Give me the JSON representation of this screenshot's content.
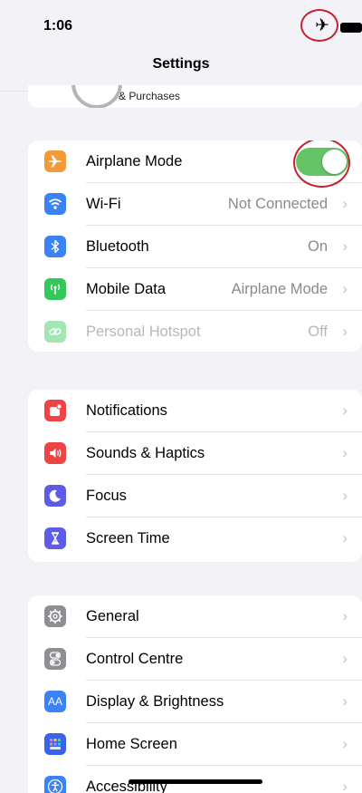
{
  "status_bar": {
    "time": "1:06"
  },
  "nav": {
    "title": "Settings"
  },
  "account": {
    "subtitle": "& Purchases"
  },
  "colors": {
    "accent_toggle": "#65c466",
    "annotation_ring": "#c8202f",
    "airplane": "#f19a37",
    "wifi": "#3b82f6",
    "bluetooth": "#3b82f6",
    "mobile_data": "#34c759",
    "hotspot": "#34c759",
    "notifications": "#ef4444",
    "sounds": "#ef4444",
    "focus": "#5e5ce6",
    "screen_time": "#5e5ce6",
    "general": "#8e8e93",
    "control_centre": "#8e8e93",
    "display": "#3b82f6",
    "home_screen": "#3b62ea",
    "accessibility": "#3b82f6"
  },
  "groups": {
    "connectivity": [
      {
        "label": "Airplane Mode",
        "icon": "airplane-icon",
        "toggle_on": true
      },
      {
        "label": "Wi-Fi",
        "value": "Not Connected",
        "icon": "wifi-icon"
      },
      {
        "label": "Bluetooth",
        "value": "On",
        "icon": "bluetooth-icon"
      },
      {
        "label": "Mobile Data",
        "value": "Airplane Mode",
        "icon": "antenna-icon"
      },
      {
        "label": "Personal Hotspot",
        "value": "Off",
        "icon": "hotspot-icon",
        "disabled": true
      }
    ],
    "alerts": [
      {
        "label": "Notifications",
        "icon": "notifications-icon"
      },
      {
        "label": "Sounds & Haptics",
        "icon": "speaker-icon"
      },
      {
        "label": "Focus",
        "icon": "moon-icon"
      },
      {
        "label": "Screen Time",
        "icon": "hourglass-icon"
      }
    ],
    "system": [
      {
        "label": "General",
        "icon": "gear-icon"
      },
      {
        "label": "Control Centre",
        "icon": "switches-icon"
      },
      {
        "label": "Display & Brightness",
        "icon": "text-size-icon",
        "icon_text": "AA"
      },
      {
        "label": "Home Screen",
        "icon": "app-grid-icon"
      },
      {
        "label": "Accessibility",
        "icon": "accessibility-icon"
      }
    ]
  },
  "chevron_glyph": "›"
}
